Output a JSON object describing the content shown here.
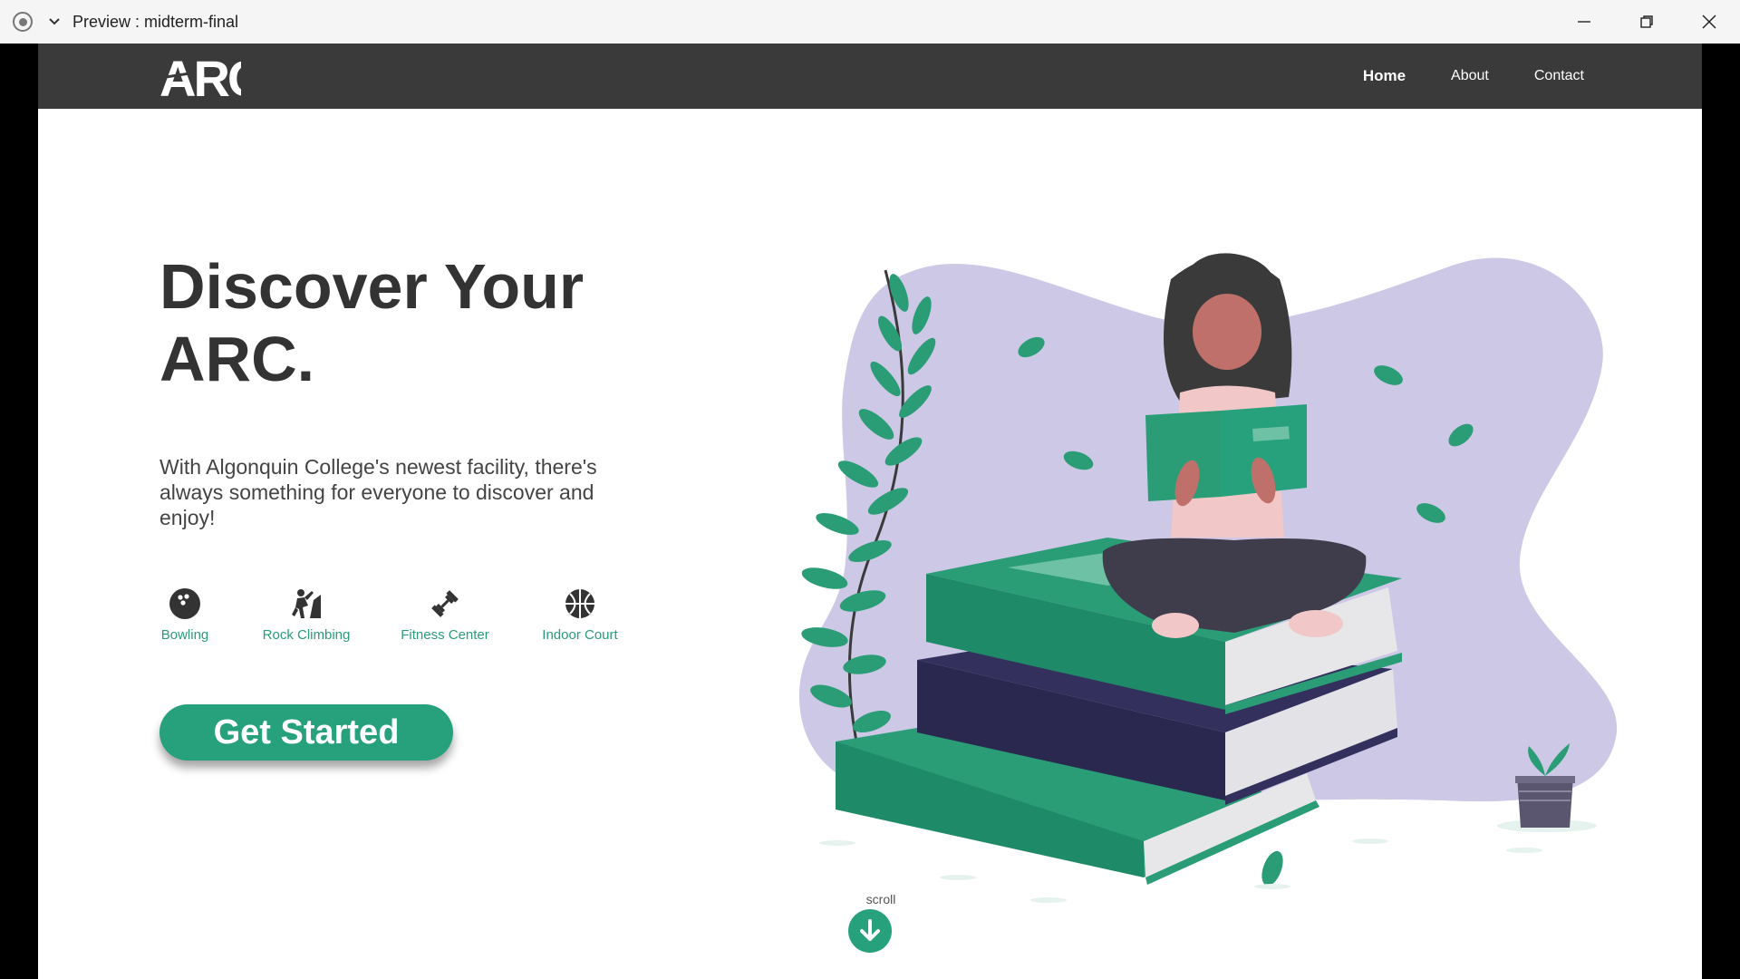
{
  "window": {
    "title": "Preview : midterm-final"
  },
  "navbar": {
    "logo_text": "ARC",
    "links": [
      {
        "label": "Home",
        "active": true
      },
      {
        "label": "About",
        "active": false
      },
      {
        "label": "Contact",
        "active": false
      }
    ]
  },
  "hero": {
    "title_line1": "Discover Your",
    "title_line2": "ARC.",
    "description": "With Algonquin College's newest facility, there's always something for everyone to discover and enjoy!",
    "features": [
      {
        "label": "Bowling",
        "icon": "bowling-ball-icon"
      },
      {
        "label": "Rock Climbing",
        "icon": "climber-icon"
      },
      {
        "label": "Fitness Center",
        "icon": "dumbbell-icon"
      },
      {
        "label": "Indoor Court",
        "icon": "basketball-icon"
      }
    ],
    "cta_label": "Get Started"
  },
  "scroll": {
    "label": "scroll",
    "icon": "arrow-down-icon"
  },
  "colors": {
    "accent": "#26a17b",
    "navbar": "#3a3a3a",
    "blob": "#cdc8e6",
    "navy_book": "#33305e"
  }
}
